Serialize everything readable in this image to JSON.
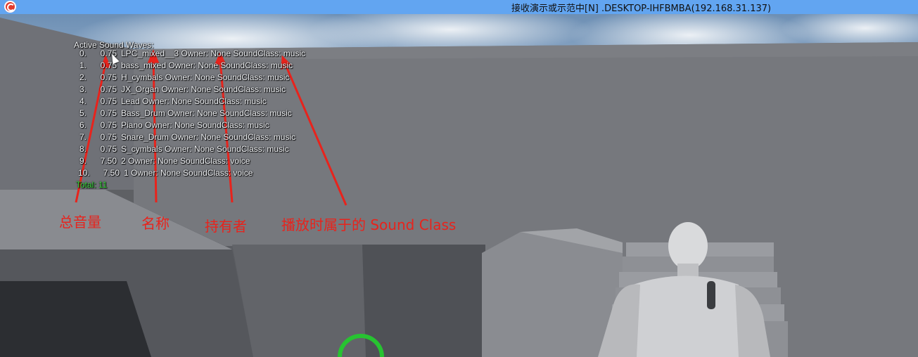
{
  "window": {
    "title": "接收演示或示范中[N] .DESKTOP-IHFBMBA(192.168.31.137)",
    "titlebar_color": "#62a5f1",
    "icon": "app-logo-icon"
  },
  "debug": {
    "header": "Active Sound Waves:",
    "rows": [
      {
        "index": "0.",
        "volume": "0.75",
        "text": "LPC_mixed__3   Owner: None   SoundClass: music"
      },
      {
        "index": "1.",
        "volume": "0.75",
        "text": "bass_mixed   Owner: None   SoundClass: music"
      },
      {
        "index": "2.",
        "volume": "0.75",
        "text": "H_cymbals   Owner: None   SoundClass: music"
      },
      {
        "index": "3.",
        "volume": "0.75",
        "text": "JX_Organ   Owner: None   SoundClass: music"
      },
      {
        "index": "4.",
        "volume": "0.75",
        "text": "Lead   Owner: None   SoundClass: music"
      },
      {
        "index": "5.",
        "volume": "0.75",
        "text": "Bass_Drum   Owner: None   SoundClass: music"
      },
      {
        "index": "6.",
        "volume": "0.75",
        "text": "Piano   Owner: None   SoundClass: music"
      },
      {
        "index": "7.",
        "volume": "0.75",
        "text": "Snare_Drum   Owner: None   SoundClass: music"
      },
      {
        "index": "8.",
        "volume": "0.75",
        "text": "S_cymbals   Owner: None   SoundClass: music"
      },
      {
        "index": "9.",
        "volume": "7.50",
        "text": "2   Owner: None   SoundClass: voice"
      },
      {
        "index": "10.",
        "volume": "7.50",
        "text": "1   Owner: None   SoundClass: voice"
      }
    ],
    "total": "Total: 11"
  },
  "annotations": {
    "total_volume": "总音量",
    "name": "名称",
    "owner": "持有者",
    "sound_class": "播放时属于的 Sound Class",
    "color": "#e8231c"
  }
}
